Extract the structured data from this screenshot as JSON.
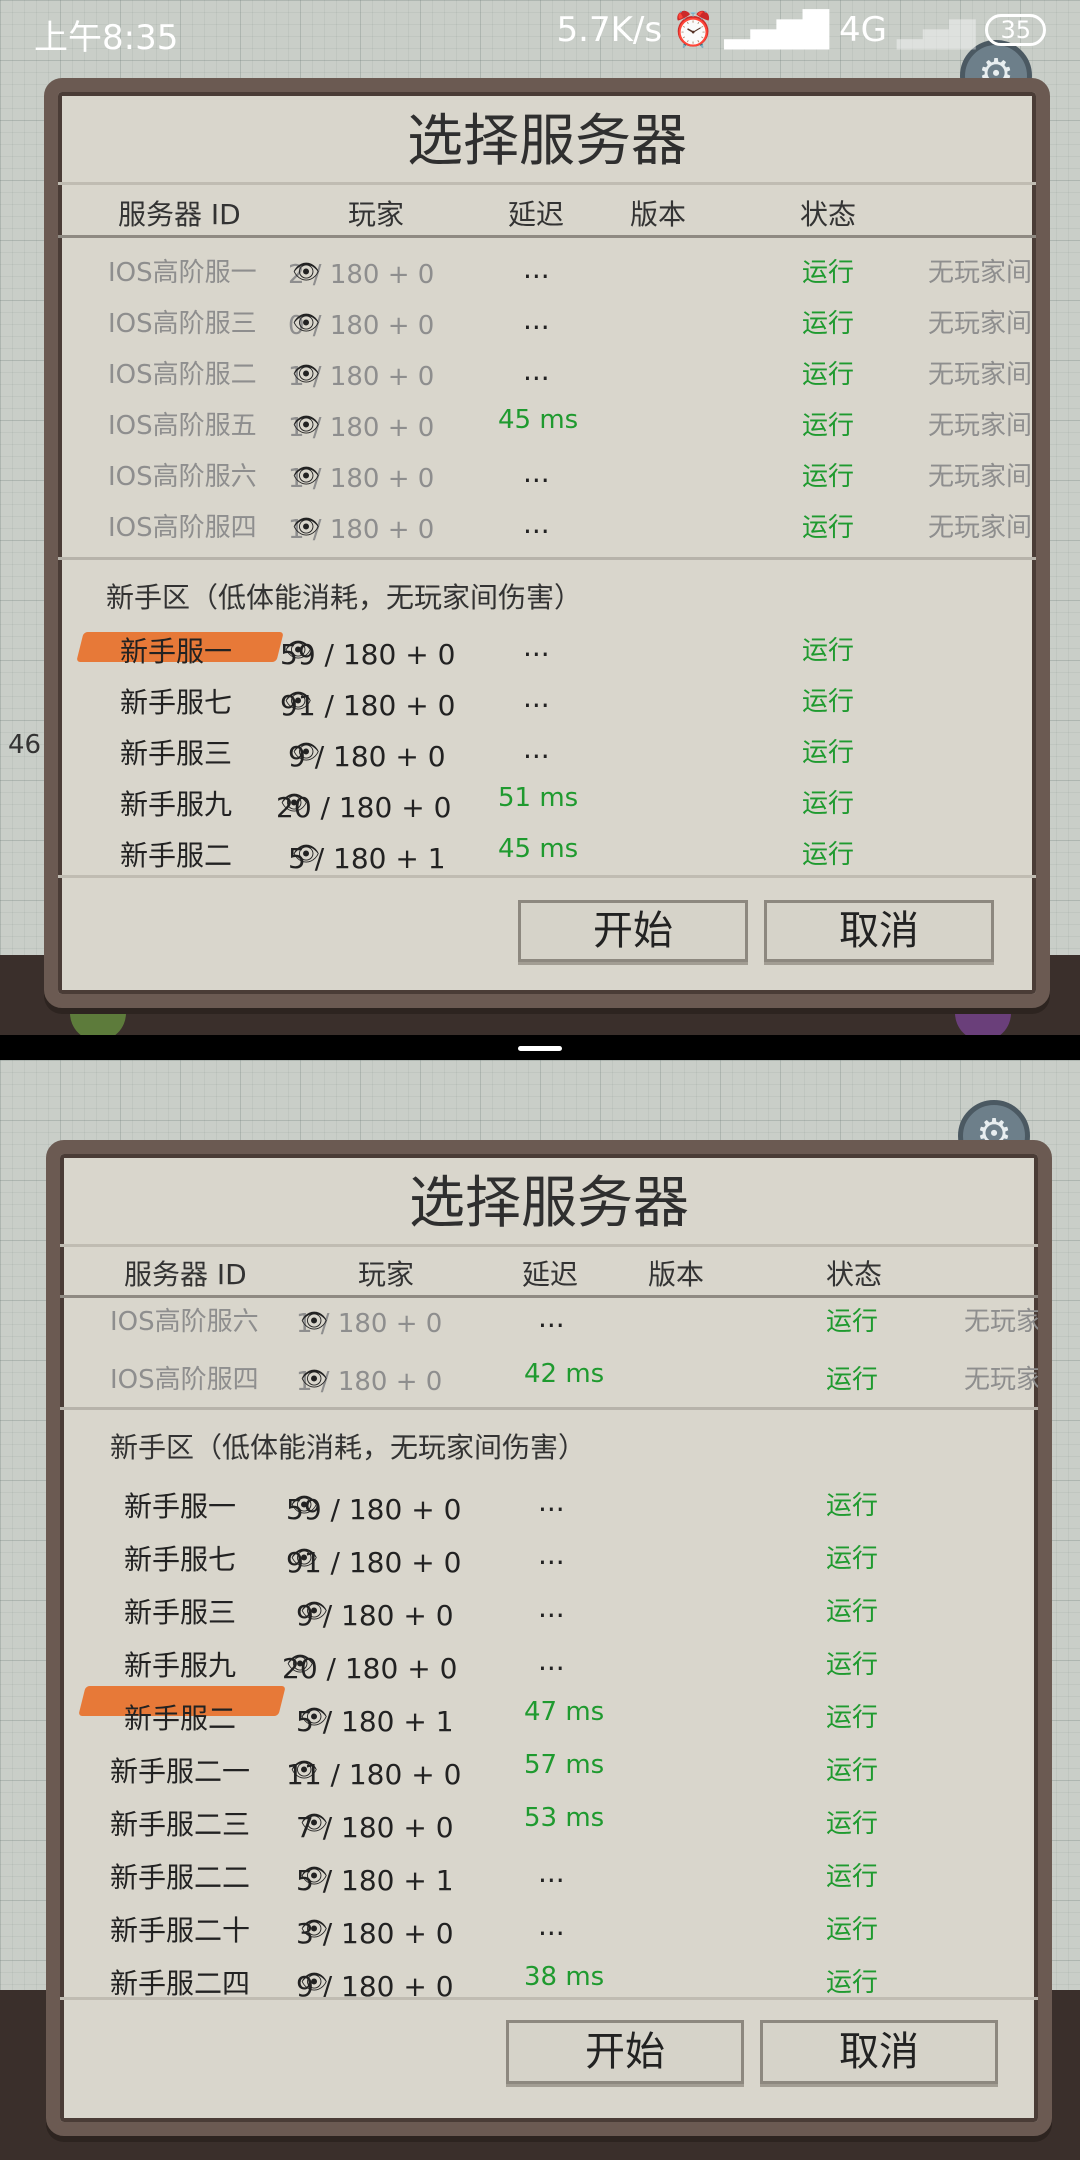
{
  "status_bar": {
    "time": "上午8:35",
    "speed": "5.7K/s",
    "network": "4G",
    "battery": "35"
  },
  "top": {
    "side_label": "46",
    "dialog": {
      "title": "选择服务器",
      "headers": {
        "id": "服务器 ID",
        "players": "玩家",
        "latency": "延迟",
        "version": "版本",
        "status": "状态"
      },
      "ios_rows": [
        {
          "name": "IOS高阶服一",
          "players": "2 / 180 + 0",
          "latency": "...",
          "status": "运行",
          "note": "无玩家间"
        },
        {
          "name": "IOS高阶服三",
          "players": "0 / 180 + 0",
          "latency": "...",
          "status": "运行",
          "note": "无玩家间"
        },
        {
          "name": "IOS高阶服二",
          "players": "1 / 180 + 0",
          "latency": "...",
          "status": "运行",
          "note": "无玩家间"
        },
        {
          "name": "IOS高阶服五",
          "players": "1 / 180 + 0",
          "latency": "45 ms",
          "status": "运行",
          "note": "无玩家间"
        },
        {
          "name": "IOS高阶服六",
          "players": "1 / 180 + 0",
          "latency": "...",
          "status": "运行",
          "note": "无玩家间"
        },
        {
          "name": "IOS高阶服四",
          "players": "1 / 180 + 0",
          "latency": "...",
          "status": "运行",
          "note": "无玩家间"
        }
      ],
      "section_title": "新手区（低体能消耗，无玩家间伤害）",
      "newbie_rows": [
        {
          "name": "新手服一",
          "players": "59 / 180 + 0",
          "latency": "...",
          "status": "运行"
        },
        {
          "name": "新手服七",
          "players": "91 / 180 + 0",
          "latency": "...",
          "status": "运行"
        },
        {
          "name": "新手服三",
          "players": "9 / 180 + 0",
          "latency": "...",
          "status": "运行"
        },
        {
          "name": "新手服九",
          "players": "20 / 180 + 0",
          "latency": "51 ms",
          "status": "运行"
        },
        {
          "name": "新手服二",
          "players": "5 / 180 + 1",
          "latency": "45 ms",
          "status": "运行"
        }
      ],
      "start": "开始",
      "cancel": "取消"
    }
  },
  "bottom": {
    "dialog": {
      "title": "选择服务器",
      "headers": {
        "id": "服务器 ID",
        "players": "玩家",
        "latency": "延迟",
        "version": "版本",
        "status": "状态"
      },
      "ios_rows": [
        {
          "name": "IOS高阶服六",
          "players": "1 / 180 + 0",
          "latency": "...",
          "status": "运行",
          "note": "无玩家"
        },
        {
          "name": "IOS高阶服四",
          "players": "1 / 180 + 0",
          "latency": "42 ms",
          "status": "运行",
          "note": "无玩家"
        }
      ],
      "section_title": "新手区（低体能消耗，无玩家间伤害）",
      "newbie_rows": [
        {
          "name": "新手服一",
          "players": "59 / 180 + 0",
          "latency": "...",
          "status": "运行"
        },
        {
          "name": "新手服七",
          "players": "91 / 180 + 0",
          "latency": "...",
          "status": "运行"
        },
        {
          "name": "新手服三",
          "players": "9 / 180 + 0",
          "latency": "...",
          "status": "运行"
        },
        {
          "name": "新手服九",
          "players": "20 / 180 + 0",
          "latency": "...",
          "status": "运行"
        },
        {
          "name": "新手服二",
          "players": "5 / 180 + 1",
          "latency": "47 ms",
          "status": "运行"
        },
        {
          "name": "新手服二一",
          "players": "11 / 180 + 0",
          "latency": "57 ms",
          "status": "运行"
        },
        {
          "name": "新手服二三",
          "players": "7 / 180 + 0",
          "latency": "53 ms",
          "status": "运行"
        },
        {
          "name": "新手服二二",
          "players": "5 / 180 + 1",
          "latency": "...",
          "status": "运行"
        },
        {
          "name": "新手服二十",
          "players": "3 / 180 + 0",
          "latency": "...",
          "status": "运行"
        },
        {
          "name": "新手服二四",
          "players": "9 / 180 + 0",
          "latency": "38 ms",
          "status": "运行"
        }
      ],
      "start": "开始",
      "cancel": "取消"
    }
  }
}
